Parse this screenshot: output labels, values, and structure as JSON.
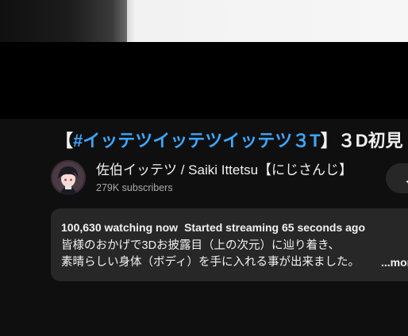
{
  "video": {
    "title_open": "【",
    "title_hashtag": "#イッテツイッテツイッテツ３T",
    "title_rest": "】３D初見"
  },
  "channel": {
    "name": "佐伯イッテツ / Saiki Ittetsu【にじさんじ】",
    "subscribers": "279K subscribers",
    "join_label": "Join"
  },
  "description": {
    "watching": "100,630 watching now",
    "started": "Started streaming 65 seconds ago",
    "line1": "皆様のおかげで3Dお披露目（上の次元）に辿り着き、",
    "line2": "素晴らしい身体（ボディ）を手に入れる事が出来ました。",
    "more_label": "...more"
  },
  "colors": {
    "background": "#0f0f0f",
    "hashtag": "#3ea6ff",
    "secondary_text": "#aaaaaa",
    "panel": "#272727"
  }
}
